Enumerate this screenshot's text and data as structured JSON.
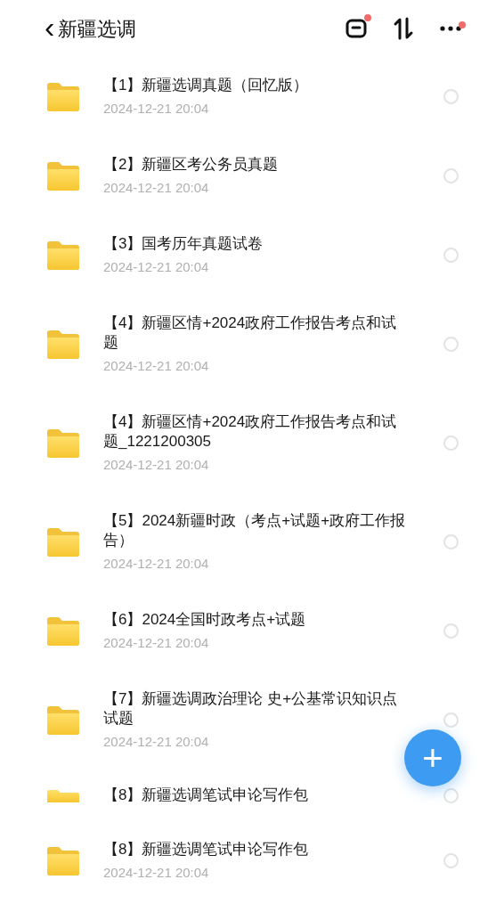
{
  "header": {
    "back": "‹",
    "title": "新疆选调",
    "actions": [
      {
        "kind": "box",
        "dot": true
      },
      {
        "kind": "sort",
        "dot": false
      },
      {
        "kind": "more",
        "dot": true
      }
    ]
  },
  "items": [
    {
      "title": "【1】新疆选调真题（回忆版）",
      "time": "2024-12-21 20:04",
      "selected": false
    },
    {
      "title": "【2】新疆区考公务员真题",
      "time": "2024-12-21 20:04",
      "selected": false
    },
    {
      "title": "【3】国考历年真题试卷",
      "time": "2024-12-21 20:04",
      "selected": false
    },
    {
      "title": "【4】新疆区情+2024政府工作报告考点和试题",
      "time": "2024-12-21 20:04",
      "selected": false
    },
    {
      "title": "【4】新疆区情+2024政府工作报告考点和试题_1221200305",
      "time": "2024-12-21 20:04",
      "selected": false
    },
    {
      "title": "【5】2024新疆时政（考点+试题+政府工作报告）",
      "time": "2024-12-21 20:04",
      "selected": false
    },
    {
      "title": "【6】2024全国时政考点+试题",
      "time": "2024-12-21 20:04",
      "selected": false
    },
    {
      "title": "【7】新疆选调政治理论 史+公基常识知识点试题",
      "time": "2024-12-21 20:04",
      "selected": false
    },
    {
      "title": "【8】新疆选调笔试申论写作包",
      "selected": false
    },
    {
      "title": "【8】新疆选调笔试申论写作包",
      "time": "2024-12-21 20:04",
      "selected": false
    }
  ],
  "fab": {
    "label": "+"
  }
}
